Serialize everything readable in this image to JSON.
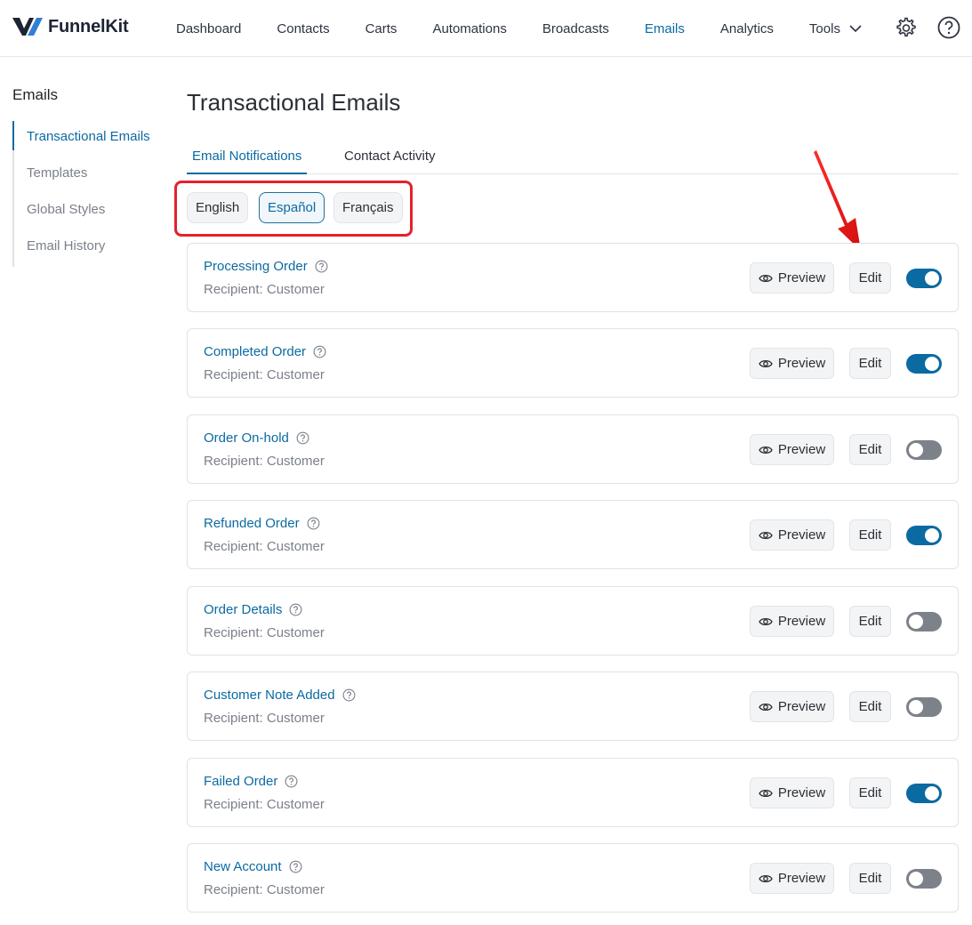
{
  "brand": {
    "name_part1": "Funnel",
    "name_part2": "Kit"
  },
  "nav": {
    "items": [
      "Dashboard",
      "Contacts",
      "Carts",
      "Automations",
      "Broadcasts",
      "Emails",
      "Analytics"
    ],
    "active": "Emails",
    "tools_label": "Tools"
  },
  "sidebar": {
    "title": "Emails",
    "items": [
      "Transactional Emails",
      "Templates",
      "Global Styles",
      "Email History"
    ],
    "active": "Transactional Emails"
  },
  "page": {
    "title": "Transactional Emails",
    "tabs": [
      "Email Notifications",
      "Contact Activity"
    ],
    "active_tab": "Email Notifications",
    "languages": [
      "English",
      "Español",
      "Français"
    ],
    "active_language": "Español"
  },
  "colors": {
    "accent": "#0b6aa2",
    "highlight": "#e4222c",
    "toggle_off": "#7d818a"
  },
  "labels": {
    "preview": "Preview",
    "edit": "Edit"
  },
  "emails": [
    {
      "title": "Processing Order",
      "recipient": "Recipient: Customer",
      "enabled": true
    },
    {
      "title": "Completed Order",
      "recipient": "Recipient: Customer",
      "enabled": true
    },
    {
      "title": "Order On-hold",
      "recipient": "Recipient: Customer",
      "enabled": false
    },
    {
      "title": "Refunded Order",
      "recipient": "Recipient: Customer",
      "enabled": true
    },
    {
      "title": "Order Details",
      "recipient": "Recipient: Customer",
      "enabled": false
    },
    {
      "title": "Customer Note Added",
      "recipient": "Recipient: Customer",
      "enabled": false
    },
    {
      "title": "Failed Order",
      "recipient": "Recipient: Customer",
      "enabled": true
    },
    {
      "title": "New Account",
      "recipient": "Recipient: Customer",
      "enabled": false
    }
  ]
}
